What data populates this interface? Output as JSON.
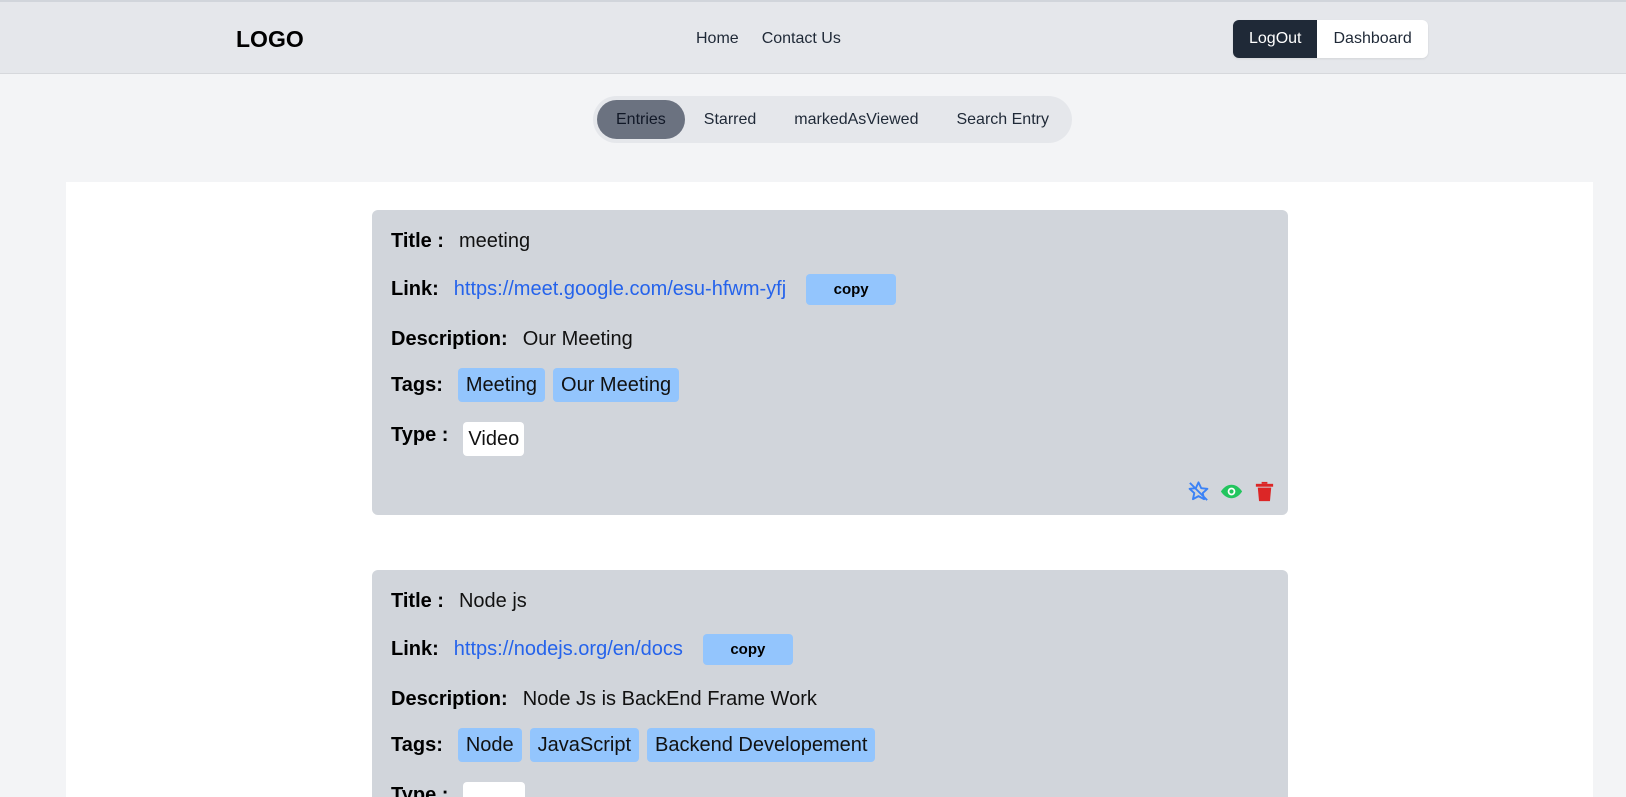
{
  "header": {
    "logo": "LOGO",
    "nav": [
      {
        "label": "Home"
      },
      {
        "label": "Contact Us"
      }
    ],
    "logout_label": "LogOut",
    "dashboard_label": "Dashboard"
  },
  "tabs": [
    {
      "label": "Entries",
      "active": true
    },
    {
      "label": "Starred",
      "active": false
    },
    {
      "label": "markedAsViewed",
      "active": false
    },
    {
      "label": "Search Entry",
      "active": false
    }
  ],
  "labels": {
    "title": "Title :",
    "link": "Link:",
    "description": "Description:",
    "tags": "Tags:",
    "type": "Type :",
    "copy": "copy"
  },
  "entries": [
    {
      "title": "meeting",
      "link": "https://meet.google.com/esu-hfwm-yfj",
      "description": "Our Meeting",
      "tags": [
        "Meeting",
        "Our Meeting"
      ],
      "type": "Video"
    },
    {
      "title": "Node js",
      "link": "https://nodejs.org/en/docs",
      "description": "Node Js is BackEnd Frame Work",
      "tags": [
        "Node",
        "JavaScript",
        "Backend Developement"
      ],
      "type": ""
    }
  ],
  "icons": {
    "star": "star-off-icon",
    "view": "eye-icon",
    "delete": "trash-icon"
  },
  "colors": {
    "accent_link": "#2563eb",
    "tag_bg": "#93c5fd",
    "star": "#3b82f6",
    "view": "#22c55e",
    "delete": "#dc2626"
  }
}
